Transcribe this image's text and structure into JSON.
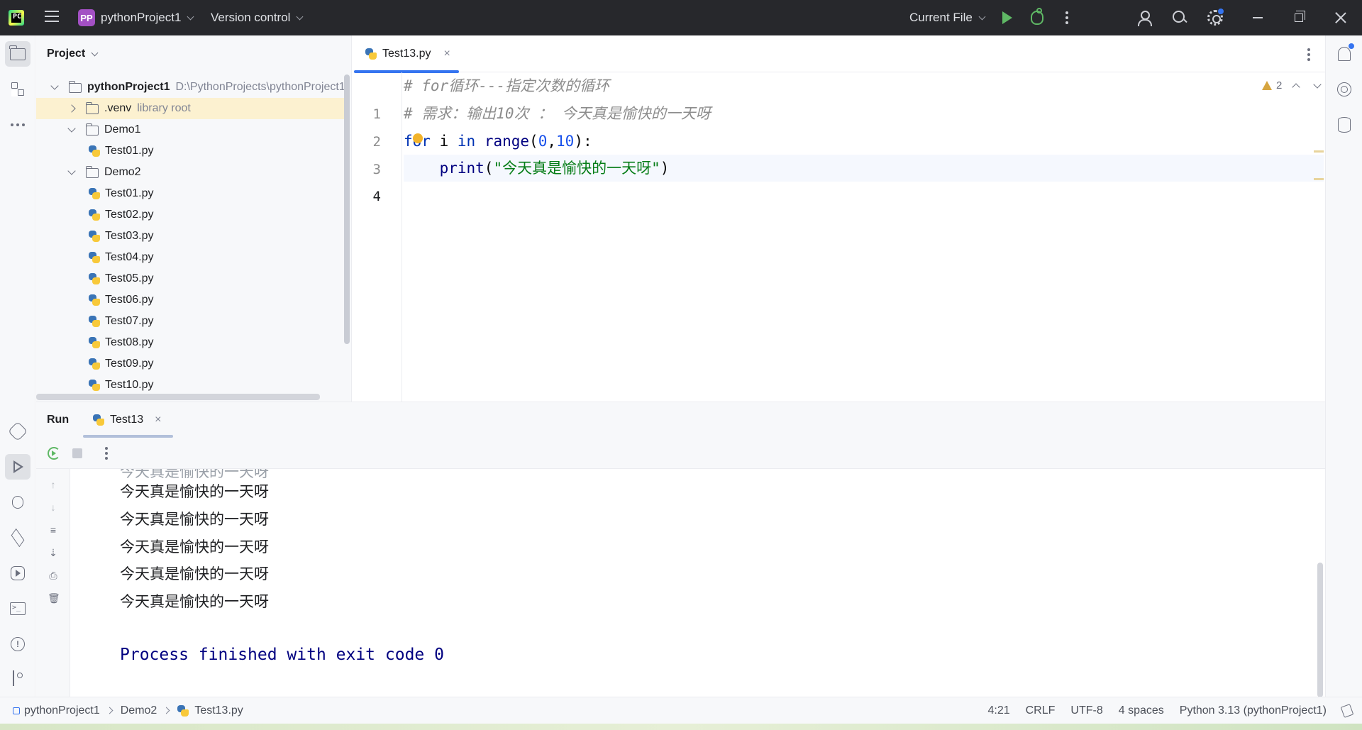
{
  "titlebar": {
    "project_badge": "PP",
    "project_name": "pythonProject1",
    "vcs_label": "Version control",
    "run_config": "Current File"
  },
  "project_panel": {
    "title": "Project",
    "tree": [
      {
        "label": "pythonProject1",
        "sub": "D:\\PythonProjects\\pythonProject1",
        "type": "folder",
        "expanded": true,
        "depth": 0
      },
      {
        "label": ".venv",
        "sub": "library root",
        "type": "folder",
        "expanded": false,
        "depth": 1,
        "selected": true
      },
      {
        "label": "Demo1",
        "type": "folder",
        "expanded": true,
        "depth": 1
      },
      {
        "label": "Test01.py",
        "type": "python",
        "depth": 2
      },
      {
        "label": "Demo2",
        "type": "folder",
        "expanded": true,
        "depth": 1
      },
      {
        "label": "Test01.py",
        "type": "python",
        "depth": 2
      },
      {
        "label": "Test02.py",
        "type": "python",
        "depth": 2
      },
      {
        "label": "Test03.py",
        "type": "python",
        "depth": 2
      },
      {
        "label": "Test04.py",
        "type": "python",
        "depth": 2
      },
      {
        "label": "Test05.py",
        "type": "python",
        "depth": 2
      },
      {
        "label": "Test06.py",
        "type": "python",
        "depth": 2
      },
      {
        "label": "Test07.py",
        "type": "python",
        "depth": 2
      },
      {
        "label": "Test08.py",
        "type": "python",
        "depth": 2
      },
      {
        "label": "Test09.py",
        "type": "python",
        "depth": 2
      },
      {
        "label": "Test10.py",
        "type": "python",
        "depth": 2
      }
    ]
  },
  "editor": {
    "tab_label": "Test13.py",
    "tab_close": "×",
    "warning_count": "2",
    "line_numbers": [
      "1",
      "2",
      "3",
      "4"
    ],
    "lines": [
      [
        {
          "t": "# for循环---指定次数的循环",
          "c": "c-comment"
        }
      ],
      [
        {
          "t": "# 需求：输出10次 ： 今天真是愉快的一天呀",
          "c": "c-comment"
        }
      ],
      [
        {
          "t": "for",
          "c": "c-kw"
        },
        {
          "t": " i ",
          "c": ""
        },
        {
          "t": "in",
          "c": "c-kw"
        },
        {
          "t": " ",
          "c": ""
        },
        {
          "t": "range",
          "c": "c-fn"
        },
        {
          "t": "(",
          "c": ""
        },
        {
          "t": "0",
          "c": "c-num"
        },
        {
          "t": ",",
          "c": ""
        },
        {
          "t": "10",
          "c": "c-num"
        },
        {
          "t": "):",
          "c": ""
        }
      ],
      [
        {
          "t": "    ",
          "c": ""
        },
        {
          "t": "print",
          "c": "c-fn"
        },
        {
          "t": "(",
          "c": ""
        },
        {
          "t": "\"今天真是愉快的一天呀\"",
          "c": "c-str"
        },
        {
          "t": ")",
          "c": ""
        }
      ]
    ]
  },
  "run_panel": {
    "title": "Run",
    "tab_label": "Test13",
    "tab_close": "×",
    "output_lines": [
      "今天真是愉快的一天呀",
      "今天真是愉快的一天呀",
      "今天真是愉快的一天呀",
      "今天真是愉快的一天呀",
      "今天真是愉快的一天呀"
    ],
    "finish_message": "Process finished with exit code 0"
  },
  "statusbar": {
    "breadcrumbs": [
      "pythonProject1",
      "Demo2",
      "Test13.py"
    ],
    "cursor_position": "4:21",
    "line_separator": "CRLF",
    "encoding": "UTF-8",
    "indent": "4 spaces",
    "interpreter": "Python 3.13 (pythonProject1)"
  },
  "colors": {
    "titlebar_bg": "#27282c",
    "accent": "#3574f0",
    "run_green": "#5fb865",
    "selection_yellow": "#fcf1d0"
  }
}
